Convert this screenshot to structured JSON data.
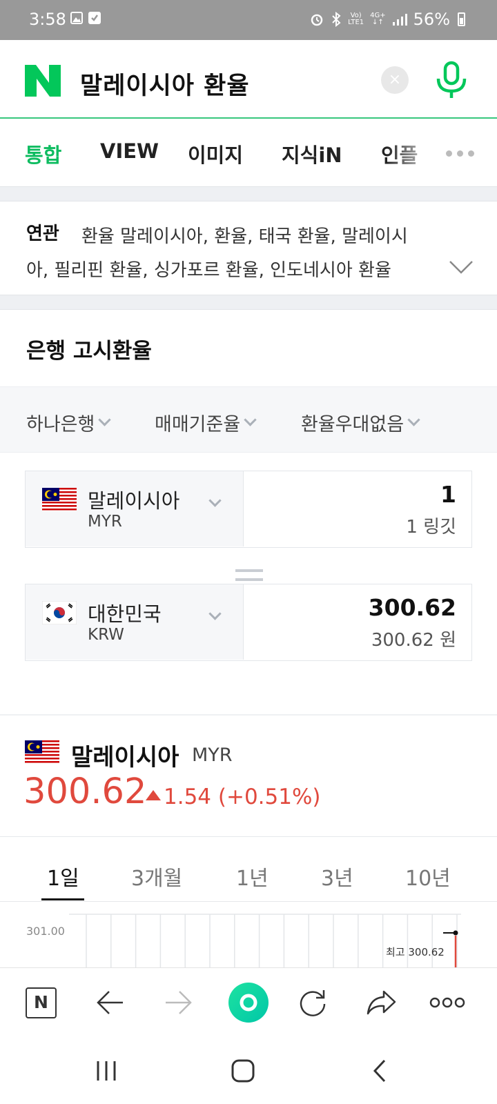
{
  "status_bar": {
    "time": "3:58",
    "battery": "56%",
    "net_top": "Vo)",
    "net_bottom": "LTE1",
    "gen_top": "4G+",
    "gen_bottom": "↓↑",
    "icons": [
      "gallery-icon",
      "check-icon",
      "alarm-icon",
      "bluetooth-icon",
      "signal-icon",
      "battery-icon"
    ]
  },
  "search": {
    "logo": "N",
    "query": "말레이시아 환율",
    "clear_label": "×",
    "brand_color": "#03c75a"
  },
  "tabs": [
    {
      "label": "통합",
      "active": true
    },
    {
      "label": "VIEW"
    },
    {
      "label": "이미지"
    },
    {
      "label": "지식iN"
    },
    {
      "label": "인플"
    }
  ],
  "related": {
    "label": "연관",
    "line1": "환율 말레이시아, 환율, 태국 환율, 말레이시",
    "line2": "아, 필리핀 환율, 싱가포르 환율, 인도네시아 환율"
  },
  "bank": {
    "title": "은행 고시환율",
    "filters": [
      "하나은행",
      "매매기준율",
      "환율우대없음"
    ],
    "from": {
      "country": "말레이시아",
      "code": "MYR",
      "amount": "1",
      "amount_text": "1 링깃"
    },
    "to": {
      "country": "대한민국",
      "code": "KRW",
      "amount": "300.62",
      "amount_text": "300.62 원"
    }
  },
  "summary": {
    "country": "말레이시아",
    "code": "MYR",
    "price": "300.62",
    "change": "1.54 (+0.51%)",
    "up_color": "#e0493d"
  },
  "periods": [
    "1일",
    "3개월",
    "1년",
    "3년",
    "10년"
  ],
  "chart": {
    "y_tick": "301.00",
    "max_label": "최고 300.62"
  },
  "chart_data": {
    "type": "line",
    "title": "",
    "xlabel": "",
    "ylabel": "",
    "y_ticks": [
      301.0
    ],
    "series": [
      {
        "values": [
          300.62
        ]
      }
    ],
    "annotations": [
      "최고 300.62"
    ],
    "grid": true
  },
  "browser_bar": {
    "home": "N",
    "icons": [
      "naver-home-icon",
      "back-arrow-icon",
      "forward-arrow-icon",
      "green-dot-icon",
      "refresh-icon",
      "share-icon",
      "more-icon"
    ]
  },
  "nav_bar": {
    "icons": [
      "recent-apps-icon",
      "home-icon",
      "back-icon"
    ]
  }
}
